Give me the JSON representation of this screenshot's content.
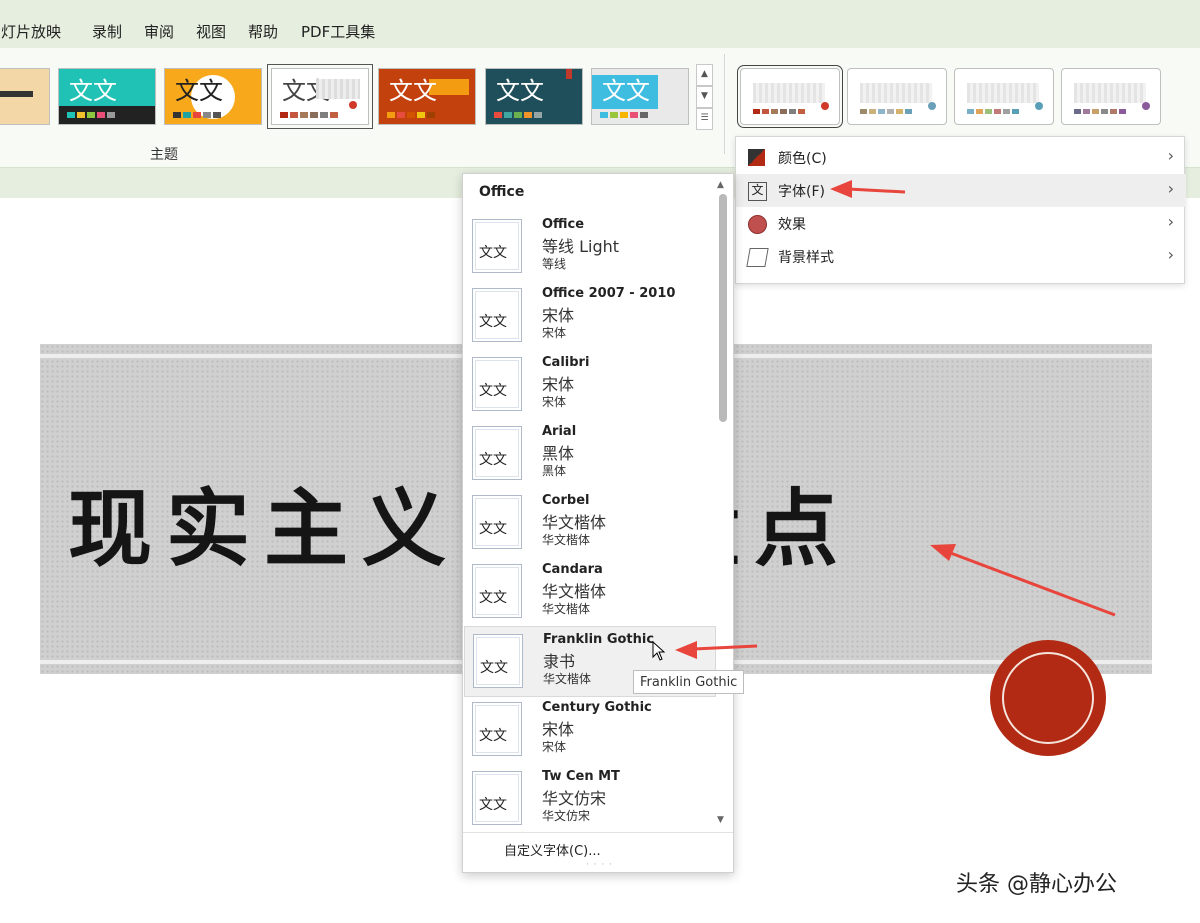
{
  "menu": {
    "items": [
      "幻灯片放映",
      "录制",
      "审阅",
      "视图",
      "帮助",
      "PDF工具集"
    ]
  },
  "themes": {
    "group_label": "主题",
    "preview_glyph": "文文"
  },
  "variant_menu": {
    "items": [
      {
        "label": "颜色(C)",
        "icon": "color-swatch-icon"
      },
      {
        "label": "字体(F)",
        "icon": "font-icon"
      },
      {
        "label": "效果",
        "icon": "effects-icon"
      },
      {
        "label": "背景样式",
        "icon": "background-style-icon"
      }
    ]
  },
  "font_gallery": {
    "header": "Office",
    "items": [
      {
        "name": "Office",
        "major": "等线 Light",
        "minor": "等线"
      },
      {
        "name": "Office 2007 - 2010",
        "major": "宋体",
        "minor": "宋体"
      },
      {
        "name": "Calibri",
        "major": "宋体",
        "minor": "宋体"
      },
      {
        "name": "Arial",
        "major": "黑体",
        "minor": "黑体"
      },
      {
        "name": "Corbel",
        "major": "华文楷体",
        "minor": "华文楷体"
      },
      {
        "name": "Candara",
        "major": "华文楷体",
        "minor": "华文楷体"
      },
      {
        "name": "Franklin Gothic",
        "major": "隶书",
        "minor": "华文楷体"
      },
      {
        "name": "Century Gothic",
        "major": "宋体",
        "minor": "宋体"
      },
      {
        "name": "Tw Cen MT",
        "major": "华文仿宋",
        "minor": "华文仿宋"
      }
    ],
    "preview_glyph": "文文",
    "customize_label": "自定义字体(C)...",
    "tooltip": "Franklin Gothic"
  },
  "slide": {
    "title": "现实主义电影盘点"
  },
  "watermark": "头条 @静心办公",
  "colors": {
    "ribbon_bg": "#e6efdf",
    "arrow_red": "#e8453c",
    "seal_red": "#b22a14"
  }
}
